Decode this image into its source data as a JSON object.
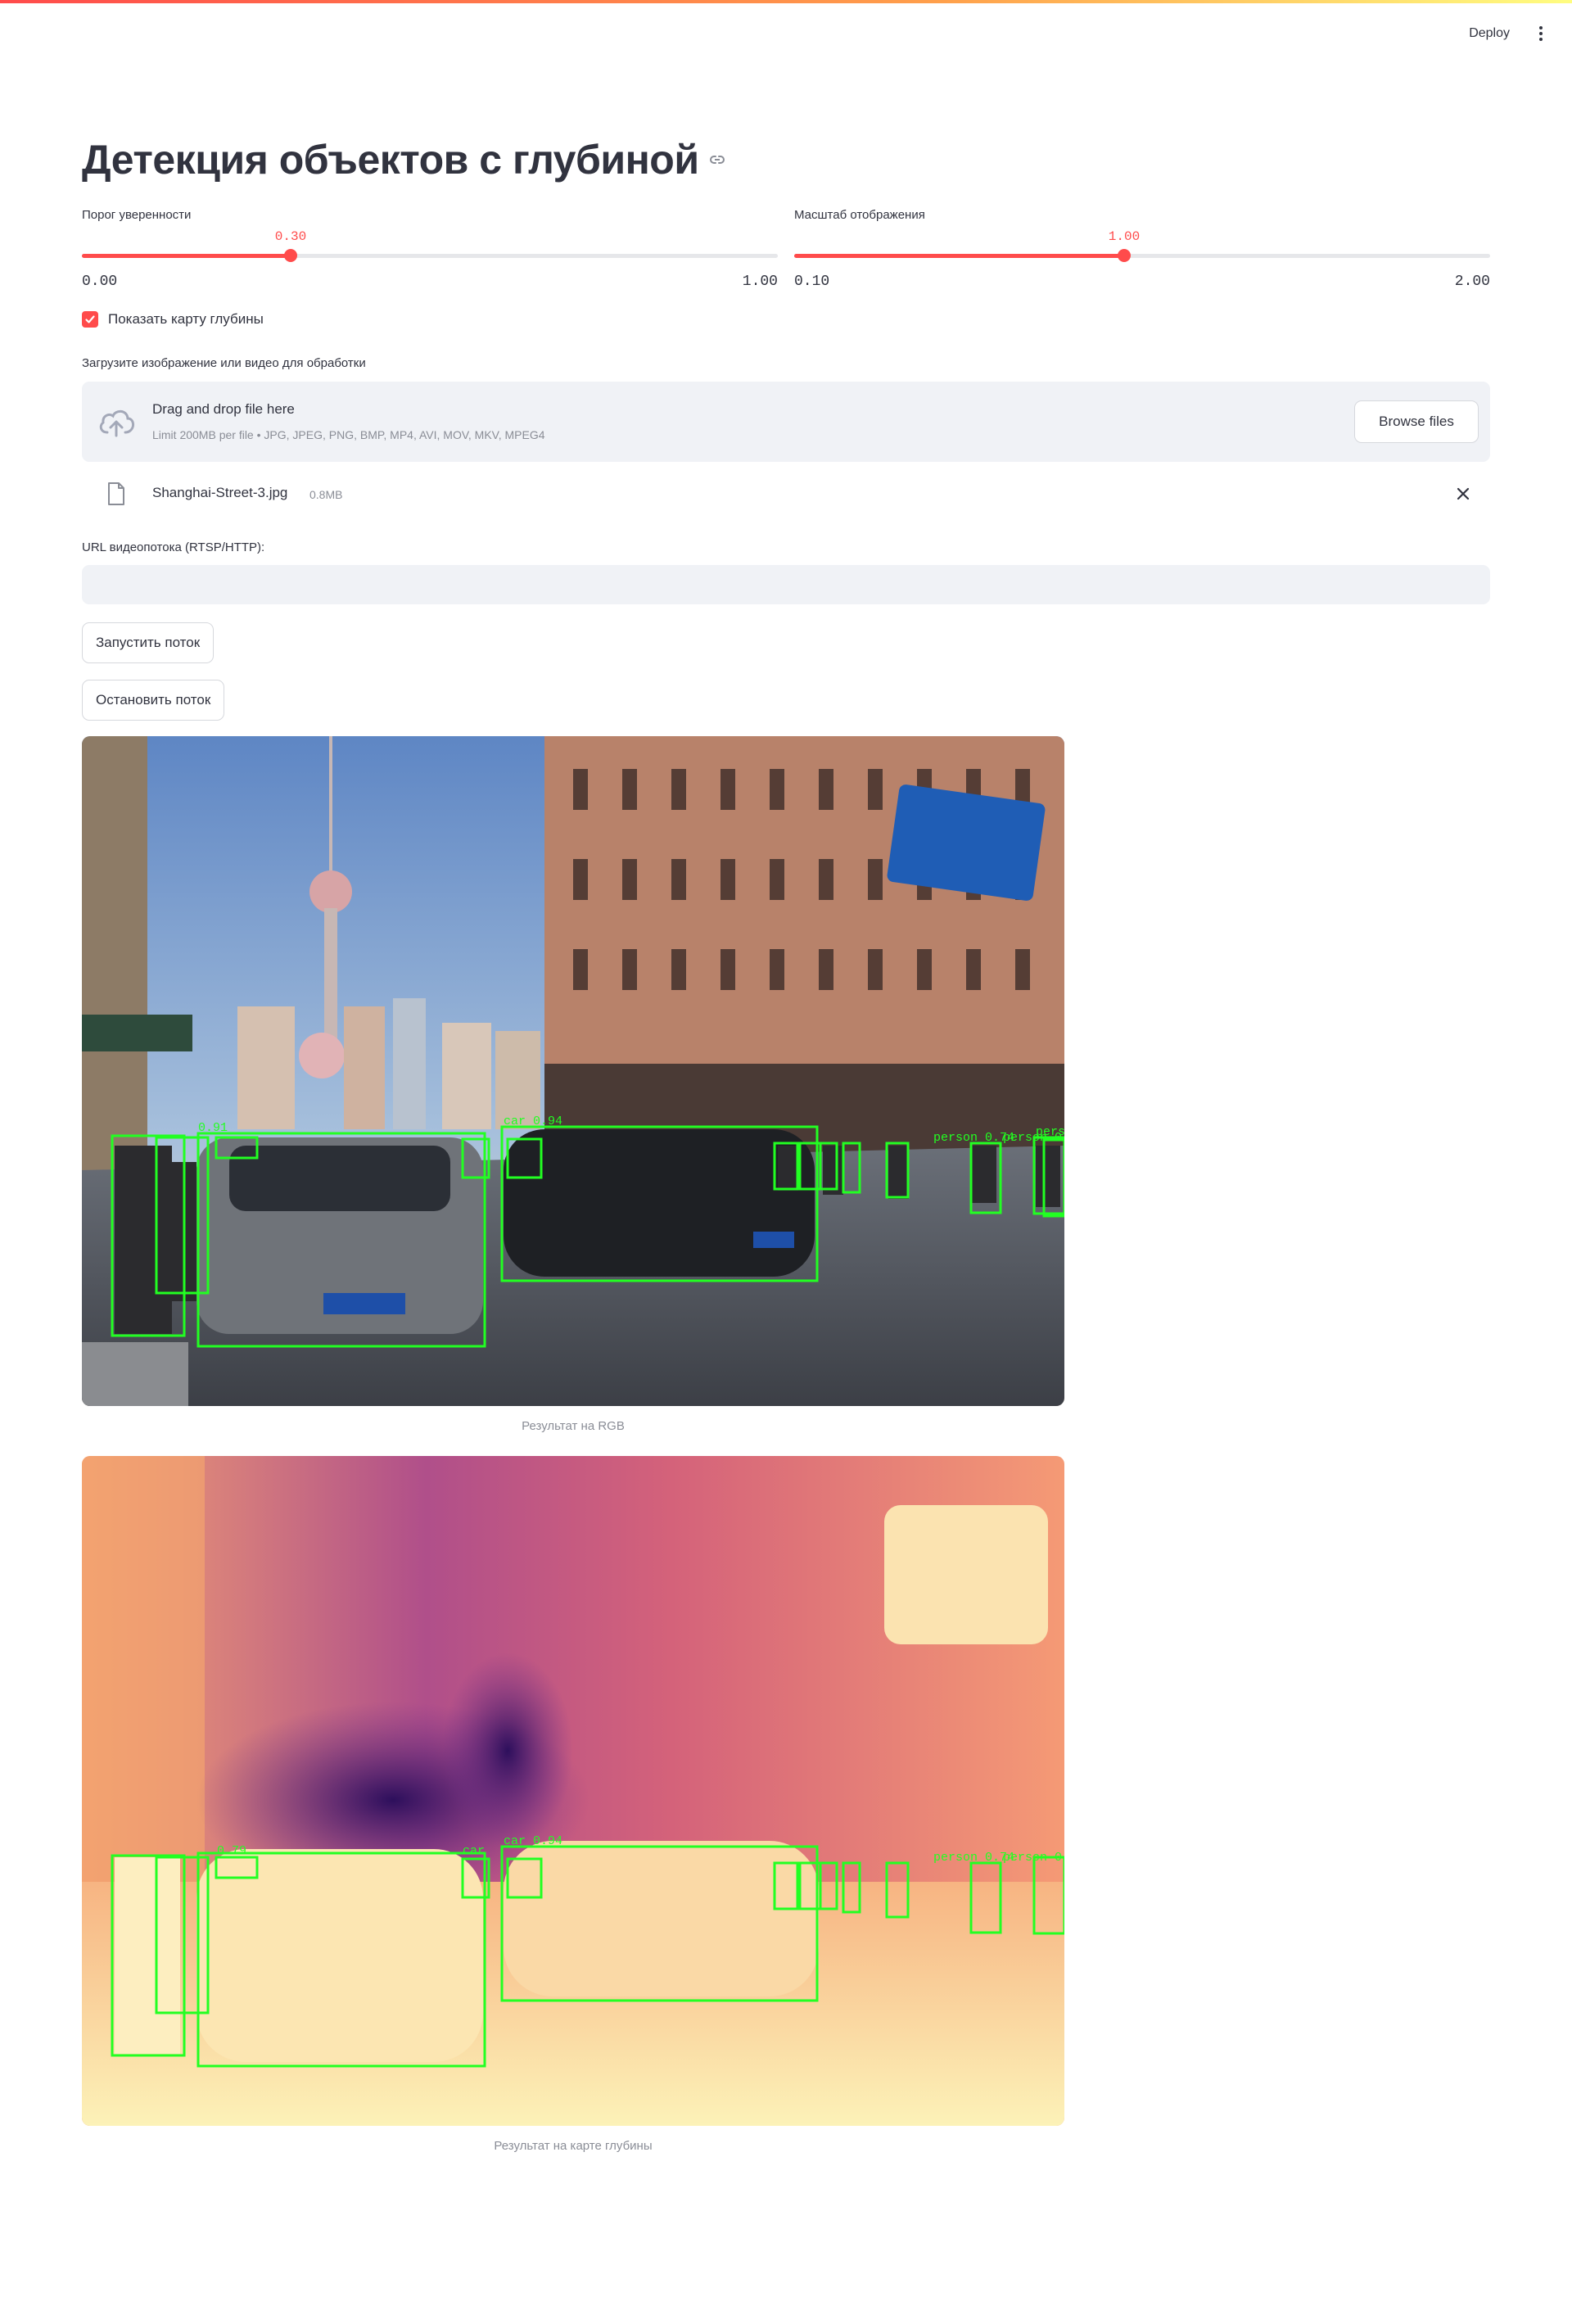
{
  "header": {
    "deploy_label": "Deploy",
    "menu_icon": "vertical-dots-icon"
  },
  "page": {
    "title": "Детекция объектов с глубиной"
  },
  "sliders": {
    "confidence": {
      "label": "Порог уверенности",
      "value": "0.30",
      "min": "0.00",
      "max": "1.00",
      "fraction": 0.3
    },
    "scale": {
      "label": "Масштаб отображения",
      "value": "1.00",
      "min": "0.10",
      "max": "2.00",
      "fraction": 0.4737
    }
  },
  "checkbox": {
    "label": "Показать карту глубины",
    "checked": true
  },
  "uploader": {
    "label": "Загрузите изображение или видео для обработки",
    "drop_title": "Drag and drop file here",
    "drop_subtitle": "Limit 200MB per file • JPG, JPEG, PNG, BMP, MP4, AVI, MOV, MKV, MPEG4",
    "browse_label": "Browse files"
  },
  "file": {
    "name": "Shanghai-Street-3.jpg",
    "size": "0.8MB"
  },
  "stream": {
    "label": "URL видеопотока (RTSP/HTTP):",
    "value": "",
    "placeholder": ""
  },
  "buttons": {
    "start": "Запустить поток",
    "stop": "Остановить поток"
  },
  "results": {
    "rgb_caption": "Результат на RGB",
    "depth_caption": "Результат на карте глубины"
  },
  "detections": {
    "labels": [
      "car 0.94",
      "car",
      "person 0.74",
      "person 0.83",
      "0.79",
      "pers",
      "0.91"
    ]
  },
  "colors": {
    "accent": "#ff4b4b",
    "box": "#22ff22",
    "text": "#31333F"
  }
}
